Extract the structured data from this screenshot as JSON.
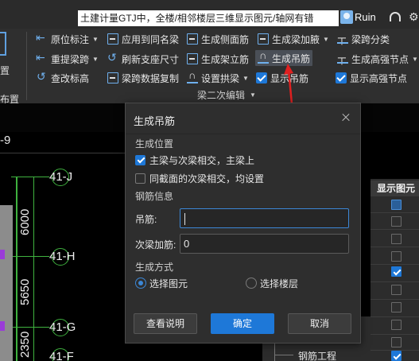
{
  "titlebar": {
    "search_text": "土建计量GTJ中，全楼/相邻楼层三维显示图元/轴网有错",
    "user_name": "Ruin",
    "support_icon": "headset-icon",
    "settings_icon": "gear-icon"
  },
  "ribbon": {
    "left_group": {
      "label_1": "置",
      "label_2": "布置"
    },
    "col1": [
      {
        "label": "原位标注",
        "has_dropdown": true
      },
      {
        "label": "重提梁跨",
        "has_dropdown": true
      },
      {
        "label": "查改标高",
        "has_dropdown": false
      }
    ],
    "col2": [
      {
        "label": "应用到同名梁"
      },
      {
        "label": "刷新支座尺寸"
      },
      {
        "label": "梁跨数据复制"
      }
    ],
    "col3": [
      {
        "label": "生成侧面筋"
      },
      {
        "label": "生成架立筋"
      },
      {
        "label": "设置拱梁",
        "has_dropdown": true
      }
    ],
    "col4": [
      {
        "label": "生成梁加腋",
        "has_dropdown": true
      },
      {
        "label": "生成吊筋",
        "active": true
      },
      {
        "label": "显示吊筋",
        "checked": true
      }
    ],
    "col5": [
      {
        "label": "梁跨分类"
      },
      {
        "label": "生成高强节点",
        "has_dropdown": true
      },
      {
        "label": "显示高强节点",
        "checked": true
      }
    ],
    "group_label": "梁二次编辑"
  },
  "canvas": {
    "top_label": "-9",
    "axes": [
      "41-J",
      "41-H",
      "41-G",
      "41-F"
    ],
    "dimensions": [
      "6000",
      "5650",
      "2350"
    ]
  },
  "right_panel": {
    "header": "显示图元",
    "rows": [
      {
        "checked": false,
        "highlight": true
      },
      {
        "checked": false
      },
      {
        "checked": false
      },
      {
        "checked": false
      },
      {
        "checked": true
      },
      {
        "checked": false
      },
      {
        "checked": false
      },
      {
        "checked": false
      },
      {
        "checked": false
      },
      {
        "checked": true
      }
    ],
    "tree_item": "钢筋工程"
  },
  "dialog": {
    "title": "生成吊筋",
    "section_position": "生成位置",
    "option_main_secondary": "主梁与次梁相交，主梁上",
    "option_main_secondary_checked": true,
    "option_same_section": "同截面的次梁相交，均设置",
    "option_same_section_checked": false,
    "section_rebar": "钢筋信息",
    "hanger_label": "吊筋:",
    "hanger_value": "",
    "extra_stirrup_label": "次梁加筋:",
    "extra_stirrup_value": "0",
    "section_mode": "生成方式",
    "radio_select_element": "选择图元",
    "radio_select_floor": "选择楼层",
    "selected_mode": "选择图元",
    "btn_help": "查看说明",
    "btn_ok": "确定",
    "btn_cancel": "取消"
  },
  "colors": {
    "accent": "#1e78d8",
    "axis_green": "#3fb23f",
    "annotation_red": "#e02020",
    "dialog_bg": "#2e2e2e"
  }
}
